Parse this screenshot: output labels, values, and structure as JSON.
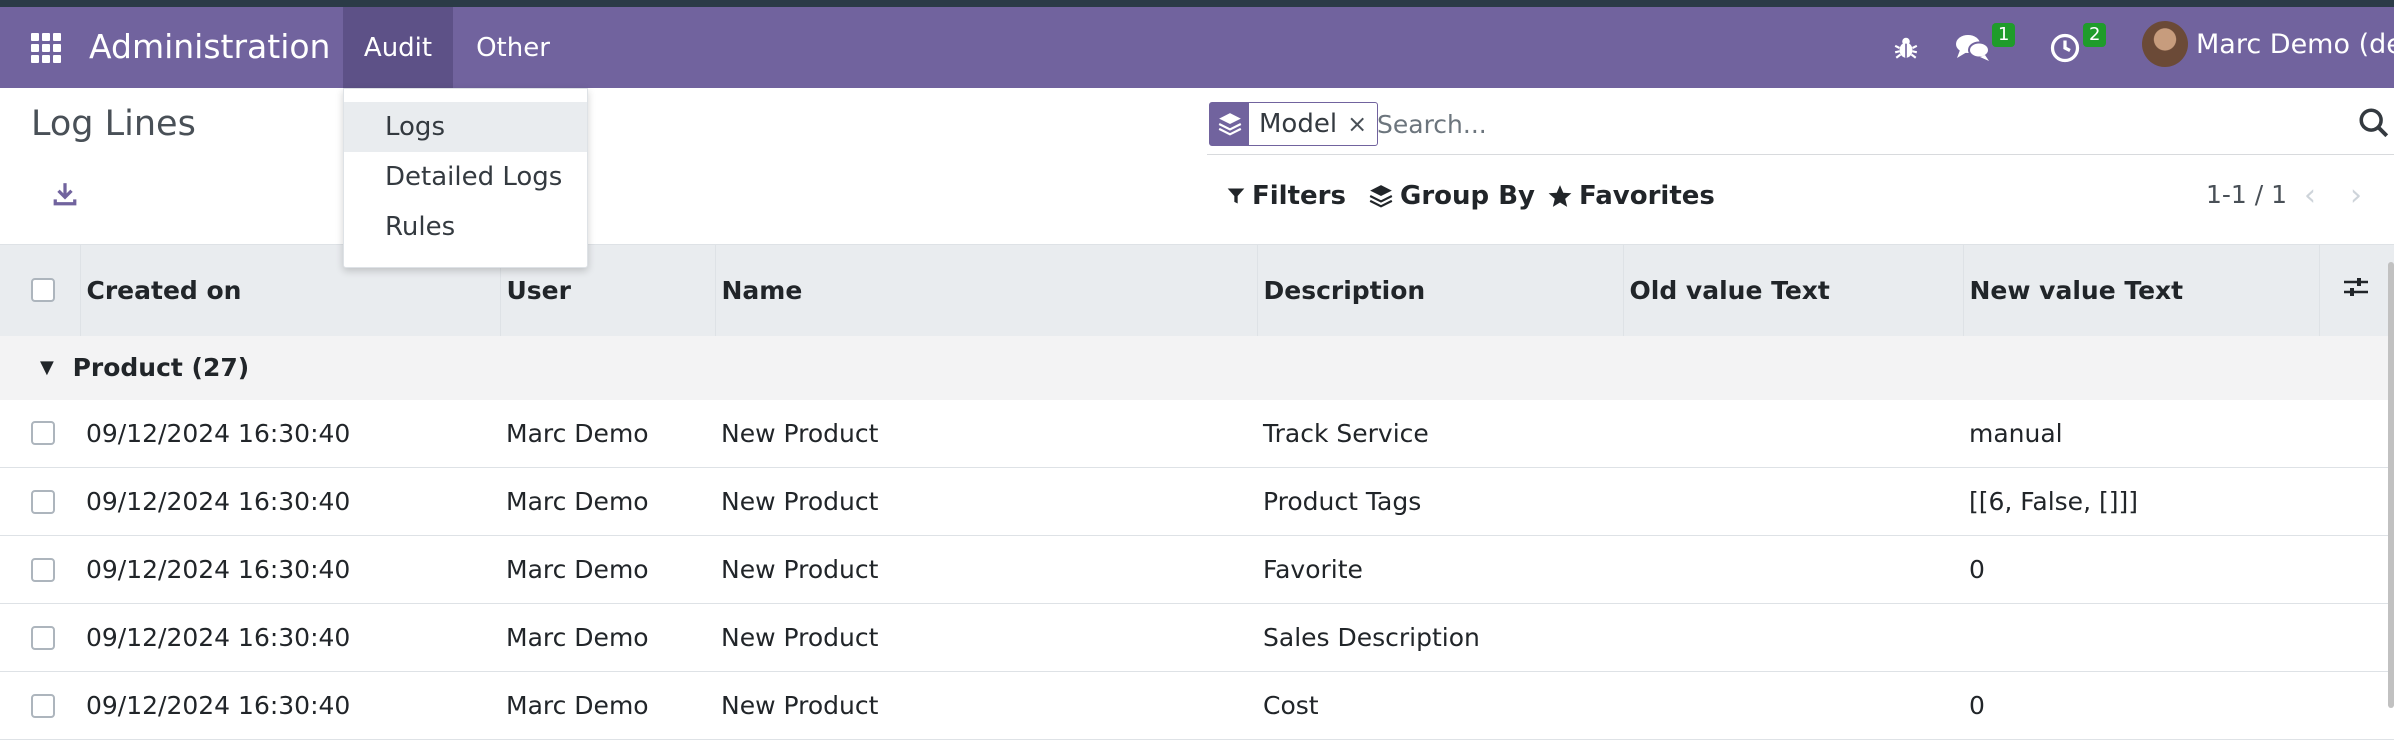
{
  "navbar": {
    "brand": "Administration",
    "menus": [
      "Audit",
      "Other"
    ],
    "chat_count": "1",
    "activity_count": "2",
    "user_name": "Marc Demo (dev)"
  },
  "dropdown": {
    "items": [
      "Logs",
      "Detailed Logs",
      "Rules"
    ]
  },
  "control_panel": {
    "title": "Log Lines",
    "facet_label": "Model",
    "facet_remove": "×",
    "search_placeholder": "Search...",
    "filters_label": "Filters",
    "groupby_label": "Group By",
    "favorites_label": "Favorites",
    "pager": "1-1 / 1"
  },
  "table": {
    "columns": [
      "Created on",
      "User",
      "Name",
      "Description",
      "Old value Text",
      "New value Text"
    ],
    "group": "Product (27)",
    "rows": [
      {
        "created_on": "09/12/2024 16:30:40",
        "user": "Marc Demo",
        "name": "New Product",
        "description": "Track Service",
        "old_value": "",
        "new_value": "manual"
      },
      {
        "created_on": "09/12/2024 16:30:40",
        "user": "Marc Demo",
        "name": "New Product",
        "description": "Product Tags",
        "old_value": "",
        "new_value": "[[6, False, []]]"
      },
      {
        "created_on": "09/12/2024 16:30:40",
        "user": "Marc Demo",
        "name": "New Product",
        "description": "Favorite",
        "old_value": "",
        "new_value": "0"
      },
      {
        "created_on": "09/12/2024 16:30:40",
        "user": "Marc Demo",
        "name": "New Product",
        "description": "Sales Description",
        "old_value": "",
        "new_value": ""
      },
      {
        "created_on": "09/12/2024 16:30:40",
        "user": "Marc Demo",
        "name": "New Product",
        "description": "Cost",
        "old_value": "",
        "new_value": "0"
      }
    ]
  },
  "colors": {
    "brand": "#71639e",
    "badge": "#1f9c2a"
  },
  "icons": [
    "apps-grid-icon",
    "bug-icon",
    "chat-icon",
    "clock-icon",
    "download-icon",
    "layers-icon",
    "search-icon",
    "filter-icon",
    "star-icon",
    "caret-down-icon",
    "chevron-left-icon",
    "chevron-right-icon",
    "column-settings-icon"
  ]
}
